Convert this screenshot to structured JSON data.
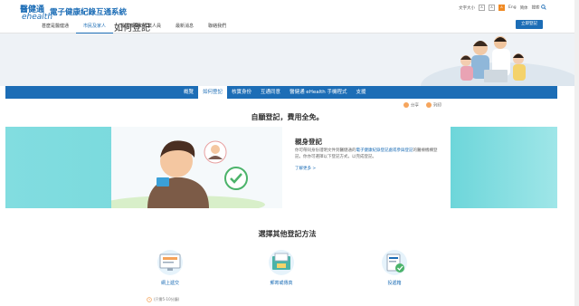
{
  "header": {
    "logo_top": "醫健通",
    "logo_bottom": "ehealth",
    "site_title": "電子健康紀錄互通系統",
    "font_size_label": "文字大小",
    "font_sizes": [
      "A",
      "A",
      "A"
    ],
    "lang_en": "Eng",
    "lang_sc": "简体",
    "search_label": "搜索",
    "login_label": "立即登記"
  },
  "nav": {
    "items": [
      {
        "label": "甚麼是醫健通"
      },
      {
        "label": "市民及家人"
      },
      {
        "label": "醫護機構和專業人員"
      },
      {
        "label": "最新消息"
      },
      {
        "label": "聯絡我們"
      }
    ]
  },
  "banner": {
    "title": "如何登記"
  },
  "subnav": {
    "items": [
      {
        "label": "概覽"
      },
      {
        "label": "如何登記"
      },
      {
        "label": "核實身份"
      },
      {
        "label": "互通同意"
      },
      {
        "label": "醫健通 eHealth 手機程式"
      },
      {
        "label": "支援"
      }
    ]
  },
  "share": {
    "share_label": "分享",
    "print_label": "列印"
  },
  "tagline": "自願登記，費用全免。",
  "register_card": {
    "title": "親身登記",
    "body_1": "你可帶同身份證明文件到醫健通的",
    "body_link": "電子健康紀錄登記處或參與登記",
    "body_2": "的醫療機構登記。你亦可選擇以下登記方式，以完成登記。",
    "more_label": "了解更多 >"
  },
  "others": {
    "title": "選擇其他登記方法",
    "methods": [
      {
        "label": "網上遞交",
        "icon": "monitor-form-icon"
      },
      {
        "label": "郵寄或傳真",
        "icon": "mail-fax-icon"
      },
      {
        "label": "投遞箱",
        "icon": "drop-box-icon"
      }
    ],
    "online_note": "(只需5-10分鐘)"
  },
  "colors": {
    "brand": "#1c6db6",
    "band": "#5fd0d4",
    "accent": "#f08a24"
  }
}
